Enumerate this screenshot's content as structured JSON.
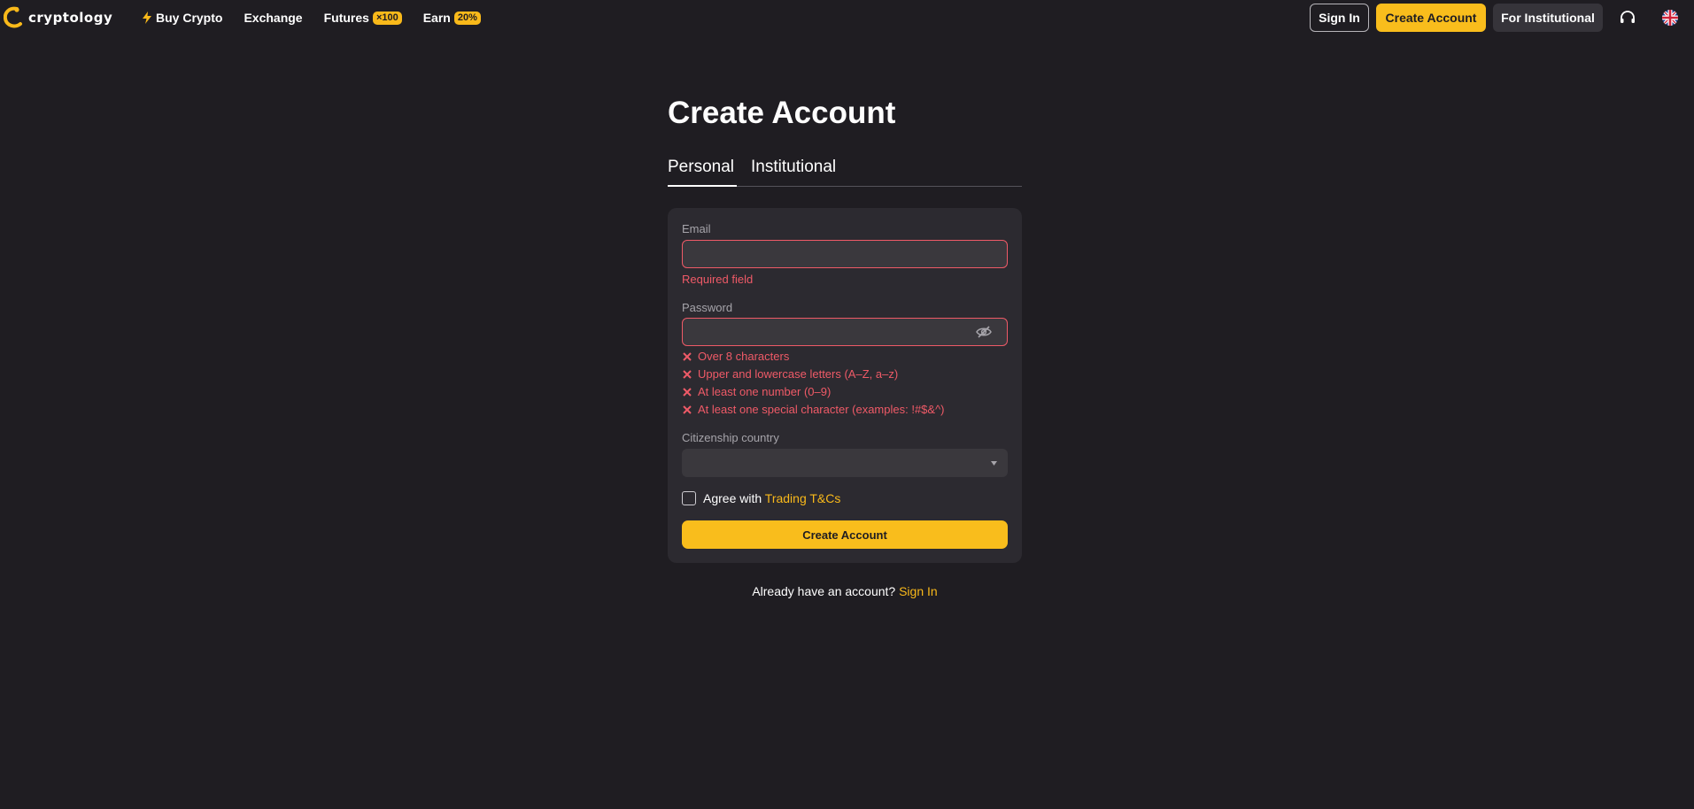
{
  "header": {
    "logo_text": "cryptology",
    "nav": [
      {
        "label": "Buy Crypto",
        "icon": "bolt-icon"
      },
      {
        "label": "Exchange"
      },
      {
        "label": "Futures",
        "badge": "×100"
      },
      {
        "label": "Earn",
        "badge": "20%"
      }
    ],
    "sign_in": "Sign In",
    "create_account": "Create Account",
    "for_institutional": "For Institutional",
    "support_icon": "headset-icon",
    "language_icon": "uk-flag-icon"
  },
  "main": {
    "title": "Create Account",
    "tabs": [
      {
        "label": "Personal",
        "active": true
      },
      {
        "label": "Institutional",
        "active": false
      }
    ],
    "form": {
      "email_label": "Email",
      "email_value": "",
      "email_error": "Required field",
      "password_label": "Password",
      "password_value": "",
      "password_rules": [
        "Over 8 characters",
        "Upper and lowercase letters (A–Z, a–z)",
        "At least one number (0–9)",
        "At least one special character (examples: !#$&^)"
      ],
      "citizenship_label": "Citizenship country",
      "citizenship_value": "",
      "agree_text": "Agree with ",
      "agree_link": "Trading T&Cs",
      "agree_checked": false,
      "submit": "Create Account"
    },
    "already_text": "Already have an account? ",
    "already_link": "Sign In"
  },
  "colors": {
    "background": "#1f1d22",
    "card": "#2c2a30",
    "accent": "#f9bd1c",
    "error": "#ef5a67"
  }
}
